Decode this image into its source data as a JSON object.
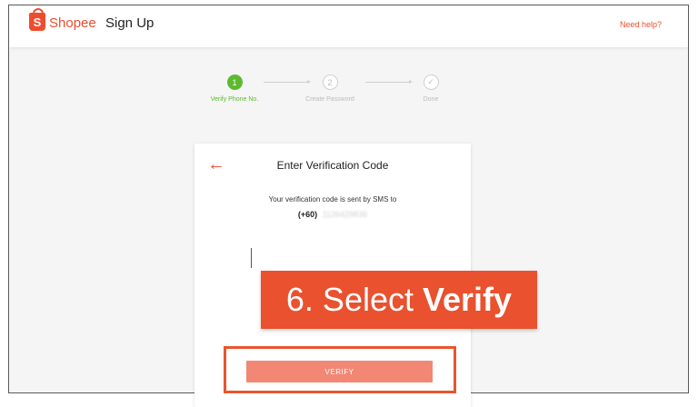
{
  "header": {
    "logo_letter": "S",
    "brand": "Shopee",
    "page_title": "Sign Up",
    "help_link": "Need help?"
  },
  "stepper": {
    "steps": [
      {
        "number": "1",
        "label": "Verify Phone No.",
        "state": "active"
      },
      {
        "number": "2",
        "label": "Create Password",
        "state": "pending"
      },
      {
        "number": "✓",
        "label": "Done",
        "state": "pending"
      }
    ]
  },
  "card": {
    "back_icon": "←",
    "title": "Enter Verification Code",
    "sms_text": "Your verification code is sent by SMS to",
    "phone_prefix": "(+60)",
    "phone_number": "1126429836",
    "verify_label": "VERIFY"
  },
  "banner": {
    "text_plain": "6. Select",
    "text_bold": "Verify"
  },
  "colors": {
    "brand": "#ee4d2d",
    "step_active": "#5dba2f",
    "verify_disabled": "#f28774",
    "banner": "#e9512f"
  }
}
